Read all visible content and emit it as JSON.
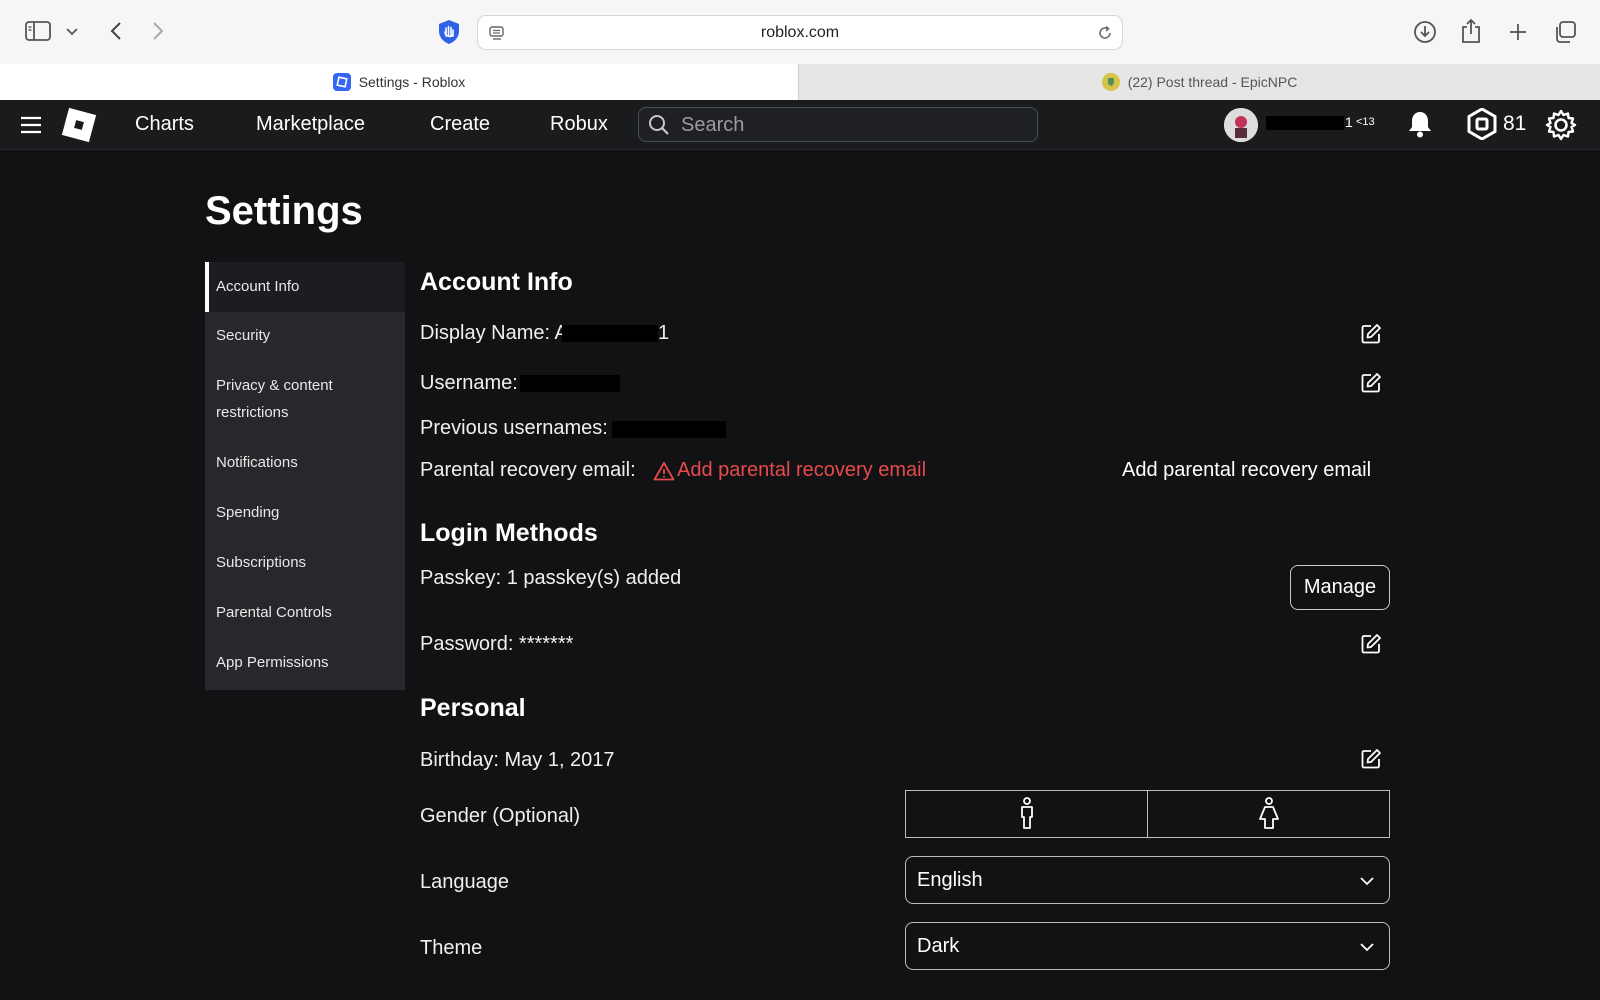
{
  "browser": {
    "url": "roblox.com",
    "tabs": [
      {
        "label": "Settings - Roblox",
        "active": true
      },
      {
        "label": "(22) Post thread - EpicNPC",
        "active": false
      }
    ]
  },
  "nav": {
    "links": [
      "Charts",
      "Marketplace",
      "Create",
      "Robux"
    ],
    "search_placeholder": "Search",
    "username_suffix": "1",
    "age_badge": "<13",
    "robux_count": "81"
  },
  "page": {
    "title": "Settings"
  },
  "sidebar": {
    "items": [
      {
        "label": "Account Info",
        "active": true
      },
      {
        "label": "Security"
      },
      {
        "label": "Privacy & content restrictions"
      },
      {
        "label": "Notifications"
      },
      {
        "label": "Spending"
      },
      {
        "label": "Subscriptions"
      },
      {
        "label": "Parental Controls"
      },
      {
        "label": "App Permissions"
      }
    ]
  },
  "account_info": {
    "heading": "Account Info",
    "display_name_label": "Display Name: A",
    "display_name_tail": "1",
    "username_label": "Username:",
    "previous_usernames_label": "Previous usernames:",
    "parental_email_label": "Parental recovery email:",
    "parental_email_warning": "Add parental recovery email",
    "parental_email_action": "Add parental recovery email"
  },
  "login_methods": {
    "heading": "Login Methods",
    "passkey_label": "Passkey: 1 passkey(s) added",
    "manage_button": "Manage",
    "password_label": "Password: *******"
  },
  "personal": {
    "heading": "Personal",
    "birthday_label": "Birthday: May 1, 2017",
    "gender_label": "Gender (Optional)",
    "language_label": "Language",
    "language_value": "English",
    "theme_label": "Theme",
    "theme_value": "Dark"
  },
  "colors": {
    "background": "#121215",
    "nav_bg": "#191b1d",
    "sidebar_bg": "#26282b",
    "warning_red": "#e64b4b",
    "browser_tab_icon_blue": "#3565f5"
  }
}
